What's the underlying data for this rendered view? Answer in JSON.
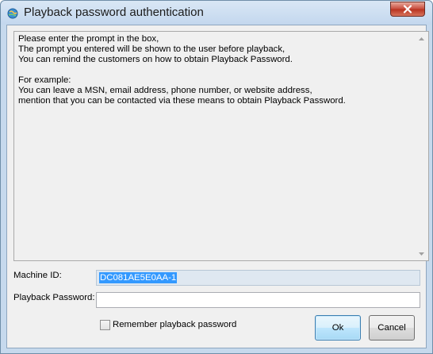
{
  "window": {
    "title": "Playback password authentication"
  },
  "prompt": {
    "text": "Please enter the prompt in the box,\nThe prompt you entered will be shown to the user before playback,\nYou can remind the customers on how to obtain Playback Password.\n\nFor example:\nYou can leave a MSN, email address, phone number, or website address,\nmention that you can be contacted via these means to obtain Playback Password."
  },
  "form": {
    "machine_id_label": "Machine ID:",
    "machine_id_value": "DC081AE5E0AA-1",
    "password_label": "Playback Password:",
    "password_value": "",
    "remember_label": "Remember playback password",
    "remember_checked": false
  },
  "buttons": {
    "ok_label": "Ok",
    "cancel_label": "Cancel"
  },
  "icons": {
    "app": "app-globe-icon",
    "close": "close-icon",
    "scroll_up": "scroll-up-arrow-icon",
    "scroll_down": "scroll-down-arrow-icon"
  },
  "colors": {
    "close_button": "#c7493a",
    "selection": "#3399ff",
    "default_button_border": "#3c7fb1"
  }
}
